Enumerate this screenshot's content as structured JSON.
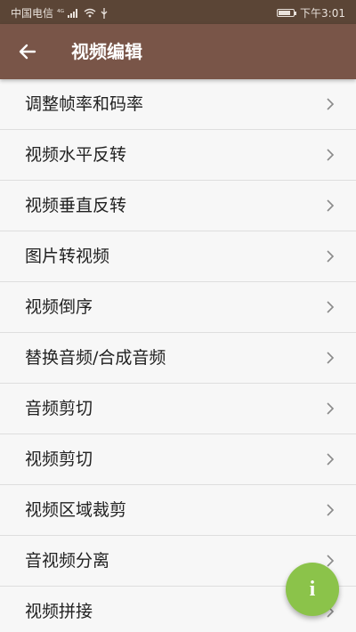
{
  "status_bar": {
    "carrier": "中国电信",
    "signal_label": "⁴ᴳ",
    "time": "下午3:01"
  },
  "app_bar": {
    "title": "视频编辑",
    "back_icon": "arrow-left-icon"
  },
  "menu": {
    "items": [
      {
        "label": "调整帧率和码率"
      },
      {
        "label": "视频水平反转"
      },
      {
        "label": "视频垂直反转"
      },
      {
        "label": "图片转视频"
      },
      {
        "label": "视频倒序"
      },
      {
        "label": "替换音频/合成音频"
      },
      {
        "label": "音频剪切"
      },
      {
        "label": "视频剪切"
      },
      {
        "label": "视频区域裁剪"
      },
      {
        "label": "音视频分离"
      },
      {
        "label": "视频拼接"
      }
    ]
  },
  "fab": {
    "label": "i",
    "color": "#8bc34a"
  },
  "colors": {
    "app_bar": "#795548",
    "status_bar": "#5b4536"
  }
}
